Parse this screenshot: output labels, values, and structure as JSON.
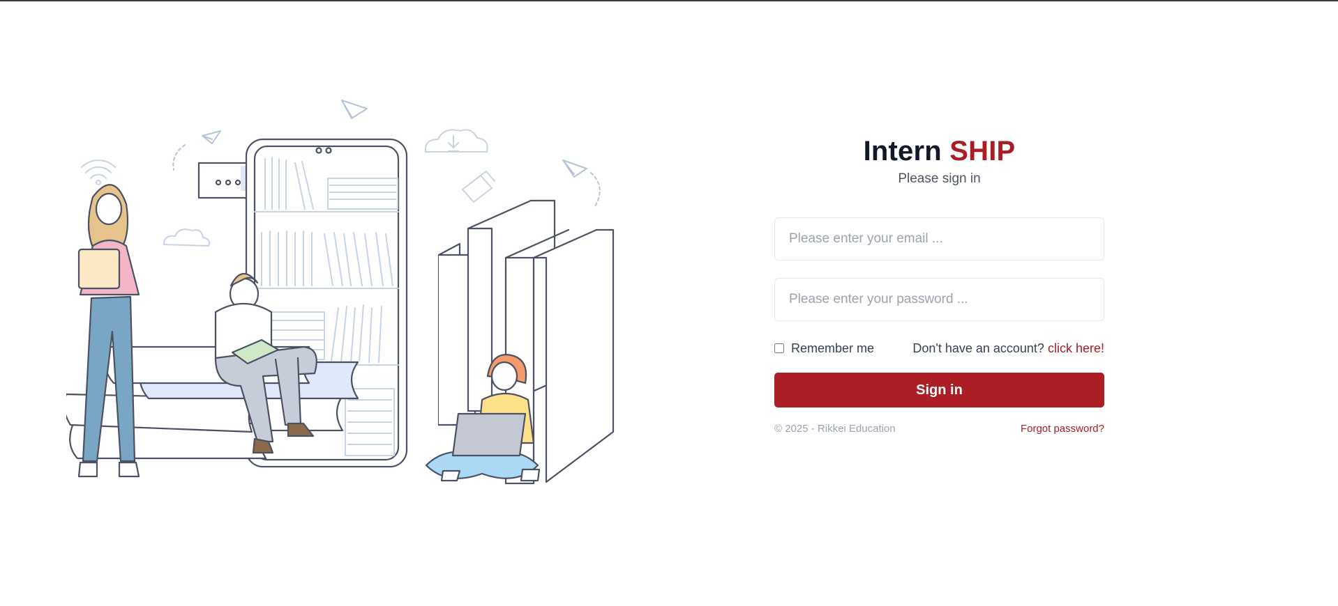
{
  "brand": {
    "part1": "Intern",
    "part2": "SHIP"
  },
  "subtitle": "Please sign in",
  "form": {
    "email_placeholder": "Please enter your email ...",
    "password_placeholder": "Please enter your password ...",
    "remember_label": "Remember me",
    "signup_prompt": "Don't have an account?",
    "signup_link": "click here!",
    "submit_label": "Sign in"
  },
  "footer": {
    "copyright": "© 2025 - Rikkei Education",
    "forgot": "Forgot password?"
  },
  "colors": {
    "accent": "#ab1e25",
    "text_dark": "#111827"
  },
  "illustration": {
    "icon": "students-with-books-illustration"
  }
}
